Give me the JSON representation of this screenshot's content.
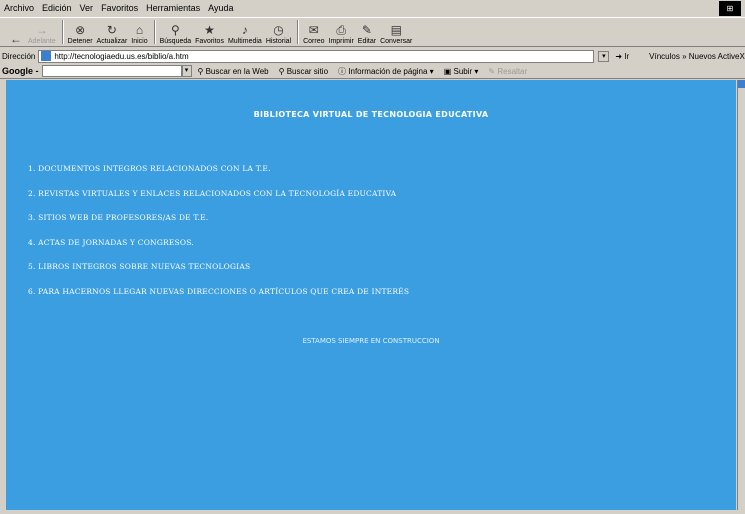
{
  "menu": [
    "Archivo",
    "Edición",
    "Ver",
    "Favoritos",
    "Herramientas",
    "Ayuda"
  ],
  "toolbar": [
    {
      "icon": "back-arrow-icon",
      "glyph": "←",
      "label": "",
      "disabled": false
    },
    {
      "icon": "forward-arrow-icon",
      "glyph": "→",
      "label": "Adelante",
      "disabled": true
    },
    {
      "icon": "stop-icon",
      "glyph": "⊗",
      "label": "Detener",
      "disabled": false
    },
    {
      "icon": "refresh-icon",
      "glyph": "↻",
      "label": "Actualizar",
      "disabled": false
    },
    {
      "icon": "home-icon",
      "glyph": "⌂",
      "label": "Inicio",
      "disabled": false
    },
    {
      "icon": "search-icon",
      "glyph": "⚲",
      "label": "Búsqueda",
      "disabled": false
    },
    {
      "icon": "favorites-icon",
      "glyph": "★",
      "label": "Favoritos",
      "disabled": false
    },
    {
      "icon": "multimedia-icon",
      "glyph": "♪",
      "label": "Multimedia",
      "disabled": false
    },
    {
      "icon": "history-icon",
      "glyph": "◷",
      "label": "Historial",
      "disabled": false
    },
    {
      "icon": "mail-icon",
      "glyph": "✉",
      "label": "Correo",
      "disabled": false
    },
    {
      "icon": "print-icon",
      "glyph": "⎙",
      "label": "Imprimir",
      "disabled": false
    },
    {
      "icon": "edit-icon",
      "glyph": "✎",
      "label": "Editar",
      "disabled": false
    },
    {
      "icon": "discuss-icon",
      "glyph": "▤",
      "label": "Conversar",
      "disabled": false
    }
  ],
  "address": {
    "label": "Dirección",
    "url": "http://tecnologiaedu.us.es/biblio/a.htm",
    "go_label": "Ir",
    "links": "Vínculos » Nuevos ActiveX"
  },
  "google": {
    "logo": "Google -",
    "search_web": "Buscar en la Web",
    "search_site": "Buscar sitio",
    "page_info": "Información de página",
    "up": "Subir",
    "highlight": "Resaltar"
  },
  "page": {
    "title": "BIBLIOTECA VIRTUAL DE TECNOLOGIA EDUCATIVA",
    "links": [
      "1. DOCUMENTOS INTEGROS RELACIONADOS CON LA T.E.",
      "2. REVISTAS VIRTUALES Y ENLACES RELACIONADOS CON LA TECNOLOGÍA EDUCATIVA",
      "3.  SITIOS WEB DE PROFESORES/AS DE T.E.",
      "4.  ACTAS DE JORNADAS Y CONGRESOS.",
      "5. LIBROS INTEGROS SOBRE NUEVAS TECNOLOGIAS",
      "6. PARA HACERNOS LLEGAR NUEVAS DIRECCIONES O ARTÍCULOS QUE CREA DE INTERÉS"
    ],
    "construction": "ESTAMOS SIEMPRE EN CONSTRUCCION"
  },
  "colors": {
    "content_bg": "#3a9ee0",
    "chrome": "#d4d0c8"
  }
}
